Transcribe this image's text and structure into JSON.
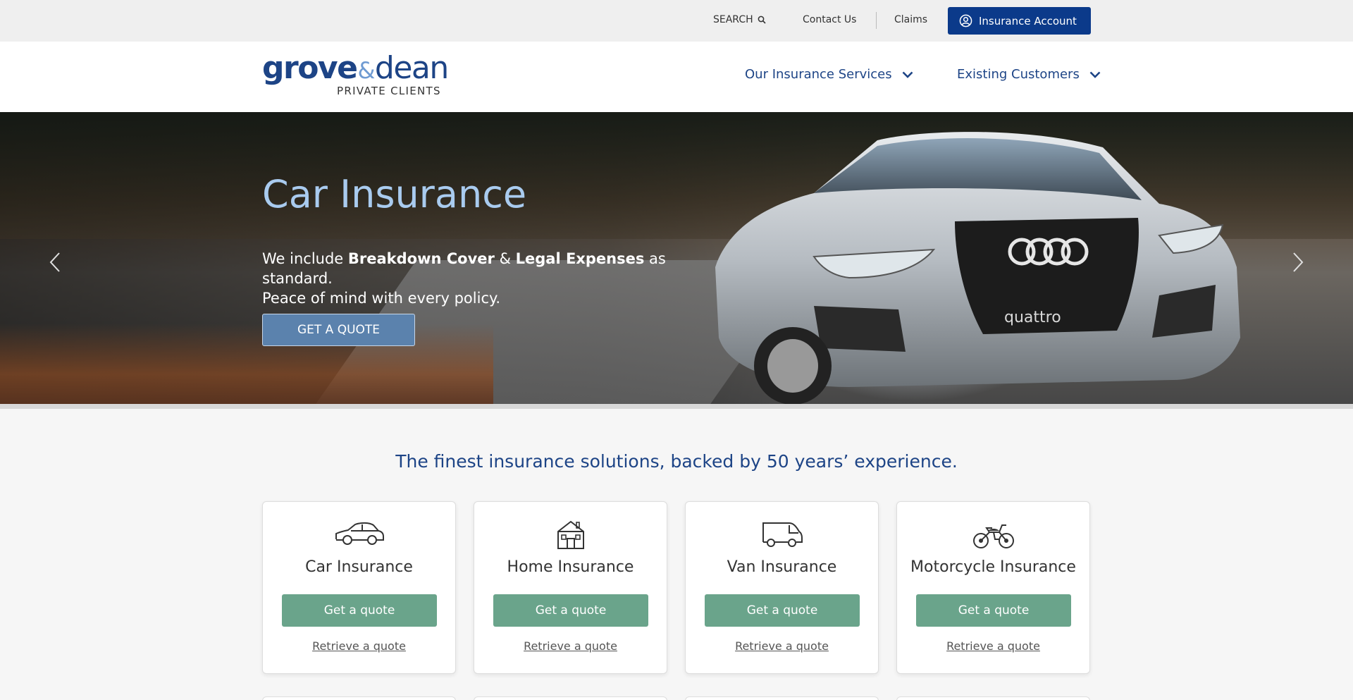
{
  "topbar": {
    "search_label": "SEARCH",
    "contact_label": "Contact Us",
    "claims_label": "Claims",
    "account_label": "Insurance Account"
  },
  "logo": {
    "word_grove": "grove",
    "word_amp": "&",
    "word_dean": "dean",
    "subtitle": "PRIVATE CLIENTS"
  },
  "nav": {
    "services_label": "Our Insurance Services",
    "customers_label": "Existing Customers"
  },
  "hero": {
    "title": "Car Insurance",
    "text_prefix": "We include ",
    "text_bold1": "Breakdown Cover",
    "text_amp": " & ",
    "text_bold2": "Legal Expenses",
    "text_suffix": " as standard.",
    "text_line2": "Peace of mind with every policy.",
    "cta_label": "GET A QUOTE",
    "car_badge": "quattro"
  },
  "tagline": "The finest insurance solutions, backed by 50 years’ experience.",
  "cards": [
    {
      "title": "Car Insurance",
      "icon": "car-icon",
      "quote_label": "Get a quote",
      "retrieve_label": "Retrieve a quote"
    },
    {
      "title": "Home Insurance",
      "icon": "house-icon",
      "quote_label": "Get a quote",
      "retrieve_label": "Retrieve a quote"
    },
    {
      "title": "Van Insurance",
      "icon": "van-icon",
      "quote_label": "Get a quote",
      "retrieve_label": "Retrieve a quote"
    },
    {
      "title": "Motorcycle Insurance",
      "icon": "motorcycle-icon",
      "quote_label": "Get a quote",
      "retrieve_label": "Retrieve a quote"
    }
  ],
  "colors": {
    "brand_navy": "#1d4486",
    "account_button": "#0b3a8a",
    "quote_green": "#6aa48b",
    "hero_title": "#a9cbef"
  }
}
